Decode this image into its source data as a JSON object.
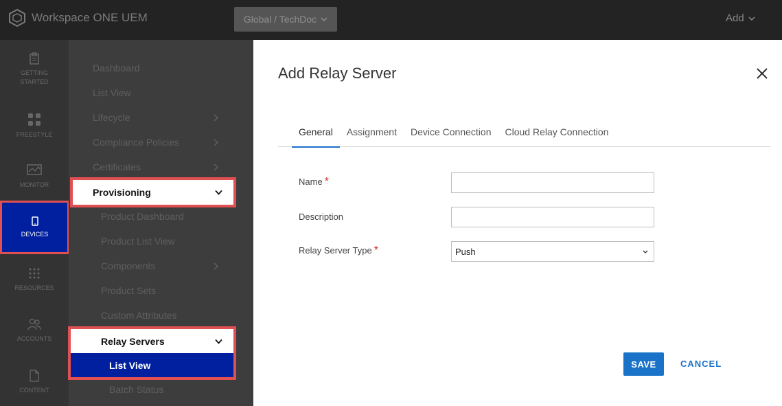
{
  "topbar": {
    "brand": "Workspace ONE UEM",
    "org_selector": "Global / TechDoc",
    "add_label": "Add"
  },
  "rail": {
    "items": [
      {
        "label_line1": "GETTING",
        "label_line2": "STARTED",
        "icon": "clipboard-icon"
      },
      {
        "label_line1": "FREESTYLE",
        "icon": "freestyle-icon"
      },
      {
        "label_line1": "MONITOR",
        "icon": "monitor-icon"
      },
      {
        "label_line1": "DEVICES",
        "icon": "phone-icon"
      },
      {
        "label_line1": "RESOURCES",
        "icon": "grid-dots-icon"
      },
      {
        "label_line1": "ACCOUNTS",
        "icon": "users-icon"
      },
      {
        "label_line1": "CONTENT",
        "icon": "document-icon"
      }
    ]
  },
  "submenu": {
    "dashboard": "Dashboard",
    "list_view": "List View",
    "lifecycle": "Lifecycle",
    "compliance": "Compliance Policies",
    "certificates": "Certificates",
    "provisioning": "Provisioning",
    "product_dashboard": "Product Dashboard",
    "product_list_view": "Product List View",
    "components": "Components",
    "product_sets": "Product Sets",
    "custom_attributes": "Custom Attributes",
    "relay_servers": "Relay Servers",
    "relay_list_view": "List View",
    "batch_status": "Batch Status"
  },
  "modal": {
    "title": "Add Relay Server",
    "tabs": [
      "General",
      "Assignment",
      "Device Connection",
      "Cloud Relay Connection"
    ],
    "fields": {
      "name_label": "Name",
      "name_value": "",
      "description_label": "Description",
      "description_value": "",
      "type_label": "Relay Server Type",
      "type_value": "Push",
      "required_mark": "*"
    },
    "save_label": "SAVE",
    "cancel_label": "CANCEL"
  }
}
